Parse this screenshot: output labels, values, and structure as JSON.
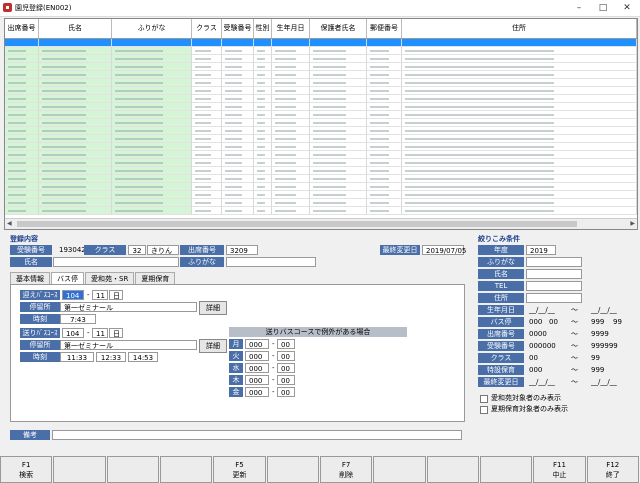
{
  "window": {
    "title": "園児登録(EN002)"
  },
  "grid": {
    "columns": [
      "出席番号",
      "氏名",
      "ふりがな",
      "クラス",
      "受験番号",
      "性別",
      "生年月日",
      "保護者氏名",
      "郵便番号",
      "住所"
    ]
  },
  "registration": {
    "section_title": "登録内容",
    "exam_no_label": "受験番号",
    "exam_no": "193042",
    "class_label": "クラス",
    "class_code": "32",
    "class_name": "きりん",
    "attend_no_label": "出席番号",
    "attend_no": "3209",
    "last_update_label": "最終変更日",
    "last_update": "2019/07/05",
    "name_label": "氏名",
    "furigana_label": "ふりがな"
  },
  "tabs": [
    "基本情報",
    "バス停",
    "愛和苑・SR",
    "夏期保育"
  ],
  "bus": {
    "pickup_label": "迎えﾊﾞｽｺｰｽ",
    "pickup_course": "104",
    "pickup_seq": "11",
    "pickup_day": "日",
    "stop_label": "停留所",
    "pickup_stop": "第一ゼミナール",
    "detail_label": "詳細",
    "time_label": "時刻",
    "pickup_time": "7:43",
    "drop_label": "送りﾊﾞｽｺｰｽ",
    "drop_course": "104",
    "drop_seq": "11",
    "drop_day": "日",
    "drop_stop": "第一ゼミナール",
    "drop_times": [
      "11:33",
      "12:33",
      "14:53"
    ]
  },
  "exceptions": {
    "title": "送りバスコースで例外がある場合",
    "days": [
      "月",
      "火",
      "水",
      "木",
      "金"
    ],
    "value_a": "000",
    "value_b": "00"
  },
  "note_label": "備考",
  "filter": {
    "title": "絞りこみ条件",
    "year_label": "年度",
    "year": "2019",
    "furigana_label": "ふりがな",
    "name_label": "氏名",
    "tel_label": "TEL",
    "address_label": "住所",
    "birth_label": "生年月日",
    "date_placeholder": "__/__/__",
    "tilde": "～",
    "bus_label": "バス停",
    "bus_from_a": "000",
    "bus_from_b": "00",
    "bus_to_a": "999",
    "bus_to_b": "99",
    "attend_label": "出席番号",
    "attend_from": "0000",
    "attend_to": "9999",
    "exam_label": "受験番号",
    "exam_from": "000000",
    "exam_to": "999999",
    "class_label": "クラス",
    "class_from": "00",
    "class_to": "99",
    "special_label": "特設保育",
    "special_from": "000",
    "special_to": "999",
    "last_update_label": "最終変更日",
    "check1": "愛和苑対象者のみ表示",
    "check2": "夏期保育対象者のみ表示"
  },
  "fkeys": [
    {
      "key": "F1",
      "label": "検索"
    },
    {
      "key": "",
      "label": ""
    },
    {
      "key": "",
      "label": ""
    },
    {
      "key": "",
      "label": ""
    },
    {
      "key": "F5",
      "label": "更新"
    },
    {
      "key": "",
      "label": ""
    },
    {
      "key": "F7",
      "label": "削除"
    },
    {
      "key": "",
      "label": ""
    },
    {
      "key": "",
      "label": ""
    },
    {
      "key": "",
      "label": ""
    },
    {
      "key": "F11",
      "label": "中止"
    },
    {
      "key": "F12",
      "label": "終了"
    }
  ]
}
